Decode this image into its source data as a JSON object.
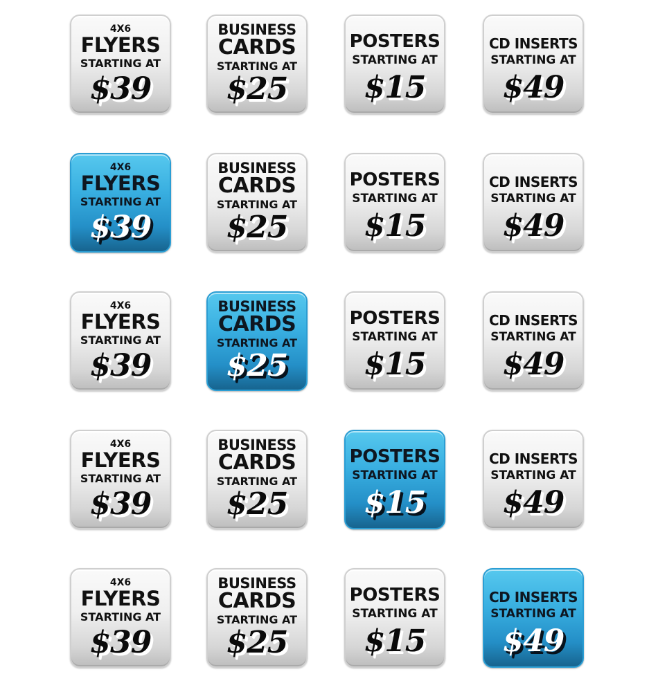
{
  "colors": {
    "active_gradient_top": "#56c8ee",
    "active_gradient_bottom": "#17648f",
    "inactive_gradient_top": "#fafafa",
    "inactive_gradient_bottom": "#bdbdbd"
  },
  "products": [
    {
      "key": "flyers",
      "icon": "flyers-price-button",
      "lines": [
        "4X6",
        "FLYERS",
        "STARTING AT"
      ],
      "price": "$39"
    },
    {
      "key": "business",
      "icon": "business-cards-price-button",
      "lines": [
        "BUSINESS",
        "CARDS",
        "STARTING AT"
      ],
      "price": "$25"
    },
    {
      "key": "posters",
      "icon": "posters-price-button",
      "lines": [
        "POSTERS",
        "STARTING AT"
      ],
      "price": "$15"
    },
    {
      "key": "cd",
      "icon": "cd-inserts-price-button",
      "lines": [
        "CD INSERTS",
        "STARTING AT"
      ],
      "price": "$49"
    }
  ],
  "rows": [
    {
      "state": "all-inactive",
      "active_index": -1
    },
    {
      "state": "flyers-active",
      "active_index": 0
    },
    {
      "state": "business-cards-active",
      "active_index": 1
    },
    {
      "state": "posters-active",
      "active_index": 2
    },
    {
      "state": "cd-inserts-active",
      "active_index": 3
    }
  ]
}
